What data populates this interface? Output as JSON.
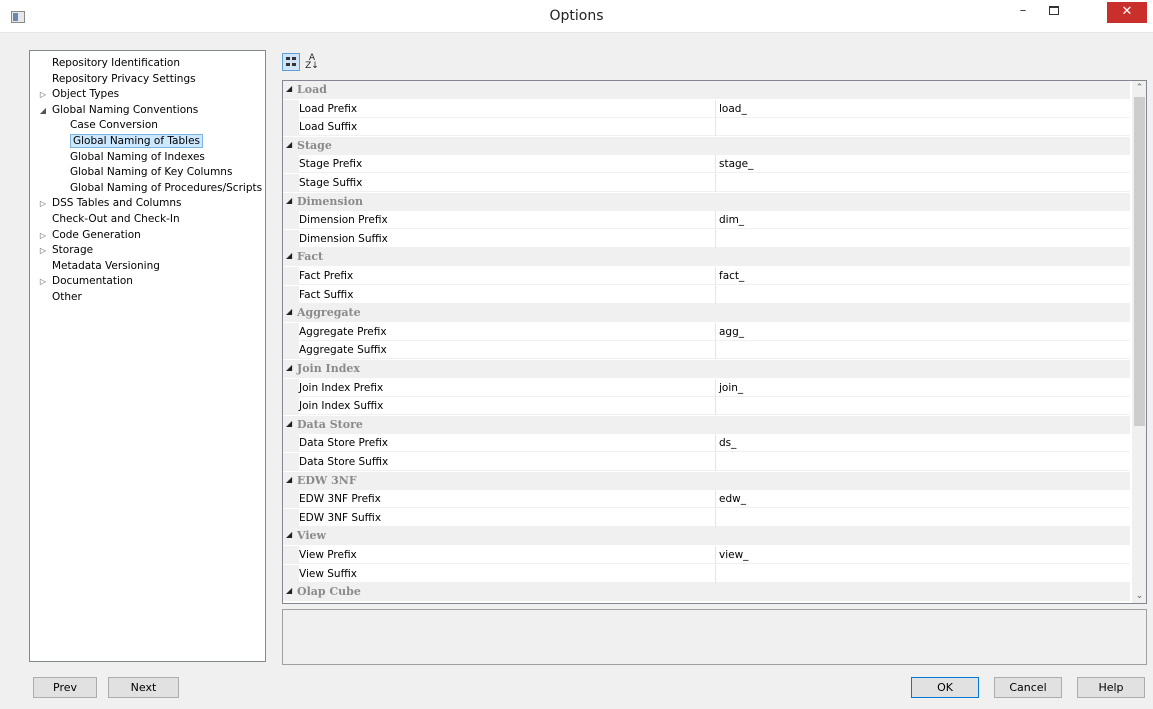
{
  "window": {
    "title": "Options",
    "minimize": "–",
    "close": "✕"
  },
  "tree": {
    "items": [
      {
        "label": "Repository Identification",
        "expander": ""
      },
      {
        "label": "Repository Privacy Settings",
        "expander": ""
      },
      {
        "label": "Object Types",
        "expander": "▷"
      },
      {
        "label": "Global Naming Conventions",
        "expander": "◢"
      },
      {
        "label": "Case Conversion",
        "expander": ""
      },
      {
        "label": "Global Naming of Tables",
        "expander": "",
        "selected": true
      },
      {
        "label": "Global Naming of Indexes",
        "expander": ""
      },
      {
        "label": "Global Naming of Key Columns",
        "expander": ""
      },
      {
        "label": "Global Naming of Procedures/Scripts",
        "expander": ""
      },
      {
        "label": "DSS Tables and Columns",
        "expander": "▷"
      },
      {
        "label": "Check-Out and Check-In",
        "expander": ""
      },
      {
        "label": "Code Generation",
        "expander": "▷"
      },
      {
        "label": "Storage",
        "expander": "▷"
      },
      {
        "label": "Metadata Versioning",
        "expander": ""
      },
      {
        "label": "Documentation",
        "expander": "▷"
      },
      {
        "label": "Other",
        "expander": ""
      }
    ]
  },
  "toolbar": {
    "sort_alpha_glyph": "A\nZ↓"
  },
  "grid": {
    "collapse_glyph": "◢",
    "categories": [
      {
        "name": "Load",
        "props": [
          {
            "name": "Load Prefix",
            "value": "load_"
          },
          {
            "name": "Load Suffix",
            "value": ""
          }
        ]
      },
      {
        "name": "Stage",
        "props": [
          {
            "name": "Stage Prefix",
            "value": "stage_"
          },
          {
            "name": "Stage Suffix",
            "value": ""
          }
        ]
      },
      {
        "name": "Dimension",
        "props": [
          {
            "name": "Dimension Prefix",
            "value": "dim_"
          },
          {
            "name": "Dimension Suffix",
            "value": ""
          }
        ]
      },
      {
        "name": "Fact",
        "props": [
          {
            "name": "Fact Prefix",
            "value": "fact_"
          },
          {
            "name": "Fact Suffix",
            "value": ""
          }
        ]
      },
      {
        "name": "Aggregate",
        "props": [
          {
            "name": "Aggregate Prefix",
            "value": "agg_"
          },
          {
            "name": "Aggregate Suffix",
            "value": ""
          }
        ]
      },
      {
        "name": "Join Index",
        "props": [
          {
            "name": "Join Index Prefix",
            "value": "join_"
          },
          {
            "name": "Join Index Suffix",
            "value": ""
          }
        ]
      },
      {
        "name": "Data Store",
        "props": [
          {
            "name": "Data Store Prefix",
            "value": "ds_"
          },
          {
            "name": "Data Store Suffix",
            "value": ""
          }
        ]
      },
      {
        "name": "EDW 3NF",
        "props": [
          {
            "name": "EDW 3NF Prefix",
            "value": "edw_"
          },
          {
            "name": "EDW 3NF Suffix",
            "value": ""
          }
        ]
      },
      {
        "name": "View",
        "props": [
          {
            "name": "View Prefix",
            "value": "view_"
          },
          {
            "name": "View Suffix",
            "value": ""
          }
        ]
      },
      {
        "name": "Olap Cube",
        "props": []
      }
    ]
  },
  "buttons": {
    "prev": "Prev",
    "next": "Next",
    "ok": "OK",
    "cancel": "Cancel",
    "help": "Help"
  }
}
